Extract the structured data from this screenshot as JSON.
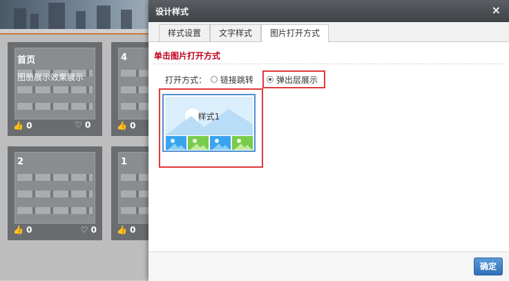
{
  "background": {
    "tiles": [
      {
        "num": "首页",
        "subtitle": "图册展示效果展示",
        "likes": "0",
        "favs": ""
      },
      {
        "num": "4",
        "subtitle": "",
        "likes": "0",
        "favs": "0"
      },
      {
        "num": "2",
        "subtitle": "",
        "likes": "0",
        "favs": "0"
      },
      {
        "num": "1",
        "subtitle": "",
        "likes": "0",
        "favs": "0"
      }
    ]
  },
  "dialog": {
    "title": "设计样式",
    "close_glyph": "×",
    "tabs": [
      {
        "label": "样式设置",
        "active": false
      },
      {
        "label": "文字样式",
        "active": false
      },
      {
        "label": "图片打开方式",
        "active": true
      }
    ],
    "section_title": "单击图片打开方式",
    "open_mode": {
      "label": "打开方式：",
      "options": [
        {
          "label": "链接跳转",
          "selected": false
        },
        {
          "label": "弹出层展示",
          "selected": true
        }
      ]
    },
    "preview": {
      "caption": "样式1"
    },
    "ok_label": "确定"
  },
  "colors": {
    "accent_red": "#e0373b",
    "section_red": "#c0001a",
    "button_blue": "#3b7cc4"
  },
  "icons": [
    "thumb-up-icon",
    "heart-icon",
    "close-icon",
    "image-icon"
  ]
}
